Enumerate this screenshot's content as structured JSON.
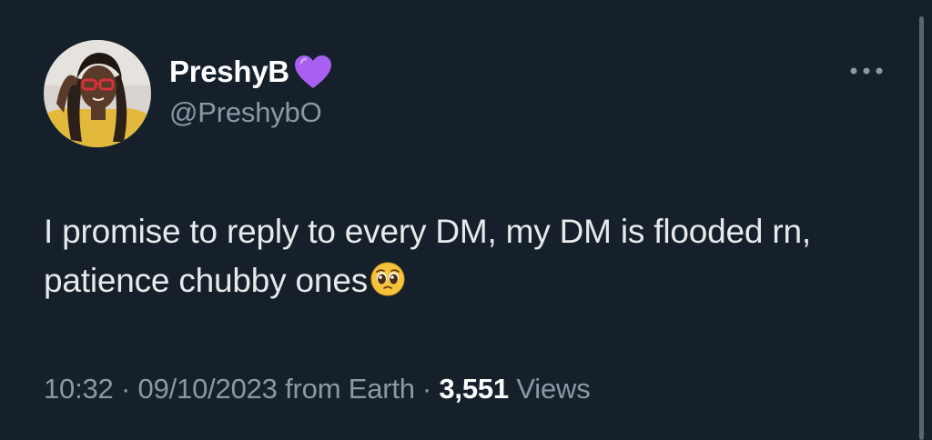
{
  "author": {
    "display_name": "PreshyB",
    "handle": "@PreshybO",
    "avatar_icon": "profile-photo-avatar",
    "badge_icon": "purple-heart-icon",
    "badge_color": "#a95ff0"
  },
  "tweet": {
    "text": "I promise to reply to every DM, my DM is flooded rn, patience chubby ones",
    "emoji_icon": "pleading-face-emoji-icon"
  },
  "meta": {
    "time": "10:32",
    "separator": "·",
    "date": "09/10/2023",
    "source": "from Earth",
    "views_count": "3,551",
    "views_label": "Views"
  },
  "actions": {
    "more_icon": "more-options-icon"
  },
  "colors": {
    "background": "#15202b",
    "primary_text": "#e7e9ea",
    "secondary_text": "#8b98a5"
  }
}
